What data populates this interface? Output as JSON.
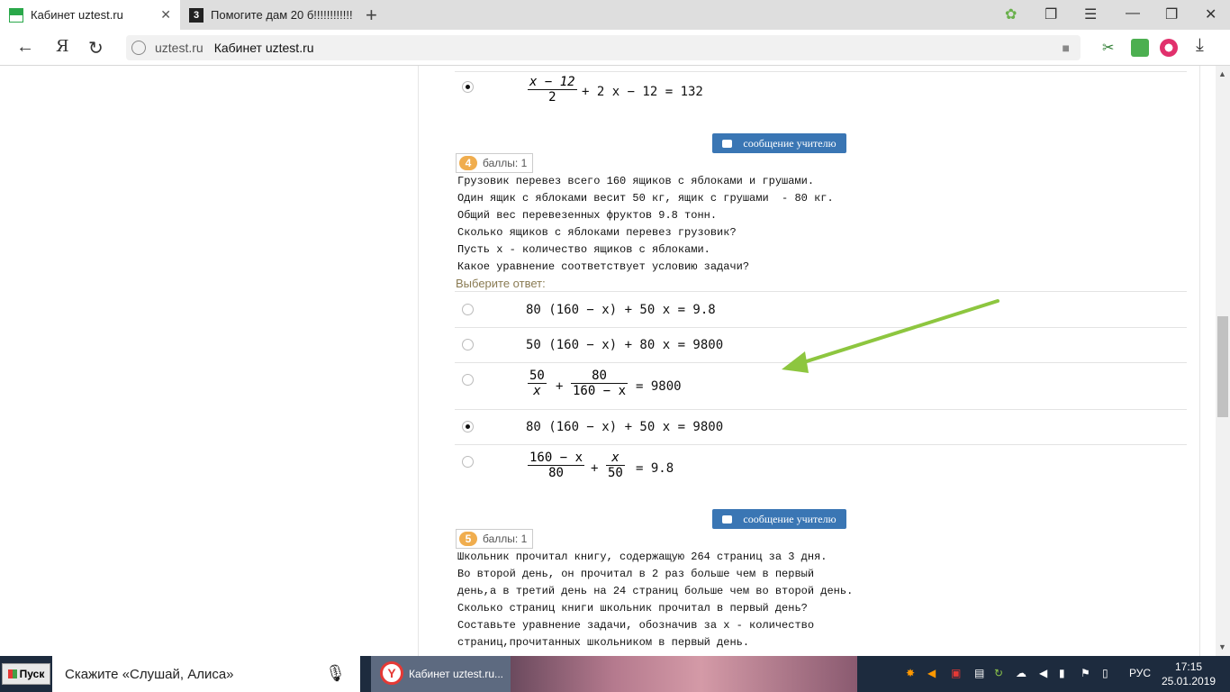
{
  "browser": {
    "tabs": [
      {
        "label": "Кабинет uztest.ru",
        "active": true
      },
      {
        "label": "Помогите дам 20 б!!!!!!!!!!!!",
        "active": false
      }
    ],
    "address": {
      "host": "uztest.ru",
      "title": "Кабинет uztest.ru"
    }
  },
  "question3_last": {
    "num": "x − 12",
    "den": "2",
    "rest": "+ 2 x − 12 = 132"
  },
  "message_button": "сообщение учителю",
  "question4": {
    "number": "4",
    "points": "баллы: 1",
    "text_lines": [
      "Грузовик перевез всего 160 ящиков с яблоками и грушами.",
      "Один ящик с яблоками весит 50 кг, ящик с грушами  - 80 кг.",
      "Общий вес перевезенных фруктов 9.8 тонн.",
      "Сколько ящиков с яблоками перевез грузовик?",
      "Пусть x - количество ящиков с яблоками.",
      "Какое уравнение соответствует условию задачи?"
    ],
    "choose_label": "Выберите ответ:",
    "options": [
      {
        "text": "80 (160 − x) + 50 x = 9.8",
        "selected": false
      },
      {
        "text": "50 (160 − x) + 80 x = 9800",
        "selected": false
      },
      {
        "frac1_num": "50",
        "frac1_den": "x",
        "plus": "+",
        "frac2_num": "80",
        "frac2_den": "160 − x",
        "rest": "= 9800",
        "selected": false
      },
      {
        "text": "80 (160 − x) + 50 x = 9800",
        "selected": true
      },
      {
        "frac1_num": "160 − x",
        "frac1_den": "80",
        "plus": "+",
        "frac2_num": "x",
        "frac2_den": "50",
        "rest": "= 9.8",
        "selected": false
      }
    ]
  },
  "question5": {
    "number": "5",
    "points": "баллы: 1",
    "text_lines": [
      "Школьник прочитал книгу, содержащую 264 страниц за 3 дня.",
      "Во второй день, он прочитал в 2 раз больше чем в первый",
      "день,а в третий день на 24 страниц больше чем во второй день.",
      "Сколько страниц книги школьник прочитал в первый день?",
      "Составьте уравнение задачи, обозначив за x - количество",
      "страниц,прочитанных школьником в первый день."
    ]
  },
  "taskbar": {
    "start": "Пуск",
    "alice": "Скажите «Слушай, Алиса»",
    "task": "Кабинет uztest.ru...",
    "lang": "РУС",
    "time": "17:15",
    "date": "25.01.2019"
  },
  "colors": {
    "accent_button": "#3a76b4",
    "badge": "#f0ad4e",
    "arrow": "#8dc63f",
    "taskbar": "#1d2b3e"
  }
}
